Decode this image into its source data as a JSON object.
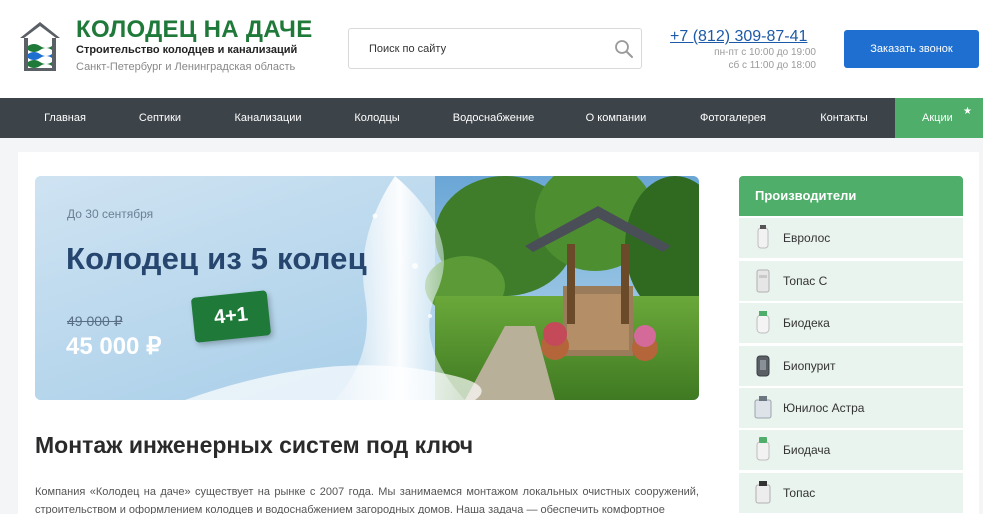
{
  "header": {
    "logo_title": "КОЛОДЕЦ НА ДАЧЕ",
    "logo_subtitle": "Строительство колодцев и канализаций",
    "logo_region": "Санкт-Петербург и Ленинградская область",
    "search_placeholder": "Поиск по сайту",
    "phone": "+7 (812) 309-87-41",
    "hours_weekdays": "пн-пт с 10:00 до 19:00",
    "hours_saturday": "сб с 11:00 до 18:00",
    "callback_label": "Заказать звонок"
  },
  "nav": {
    "items": [
      "Главная",
      "Септики",
      "Канализации",
      "Колодцы",
      "Водоснабжение",
      "О компании",
      "Фотогалерея",
      "Контакты"
    ],
    "promo": "Акции",
    "promo_star": "★"
  },
  "banner": {
    "date": "До 30 сентября",
    "title": "Колодец из 5 колец",
    "old_price": "49 000 ₽",
    "new_price": "45 000 ₽",
    "badge": "4+1"
  },
  "main": {
    "title": "Монтаж инженерных систем под ключ",
    "intro": "Компания «Колодец на даче» существует на рынке с 2007 года. Мы занимаемся монтажом локальных очистных сооружений, строительством и оформлением колодцев и водоснабжением загородных домов. Наша задача — обеспечить комфортное"
  },
  "sidebar": {
    "title": "Производители",
    "items": [
      "Евролос",
      "Топас С",
      "Биодека",
      "Биопурит",
      "Юнилос Астра",
      "Биодача",
      "Топас"
    ]
  },
  "colors": {
    "brand_green": "#1f7a3a",
    "accent_green": "#4eae6a",
    "nav_bg": "#3c4349",
    "button_blue": "#1f6fd1",
    "phone_blue": "#1c5aa8"
  }
}
